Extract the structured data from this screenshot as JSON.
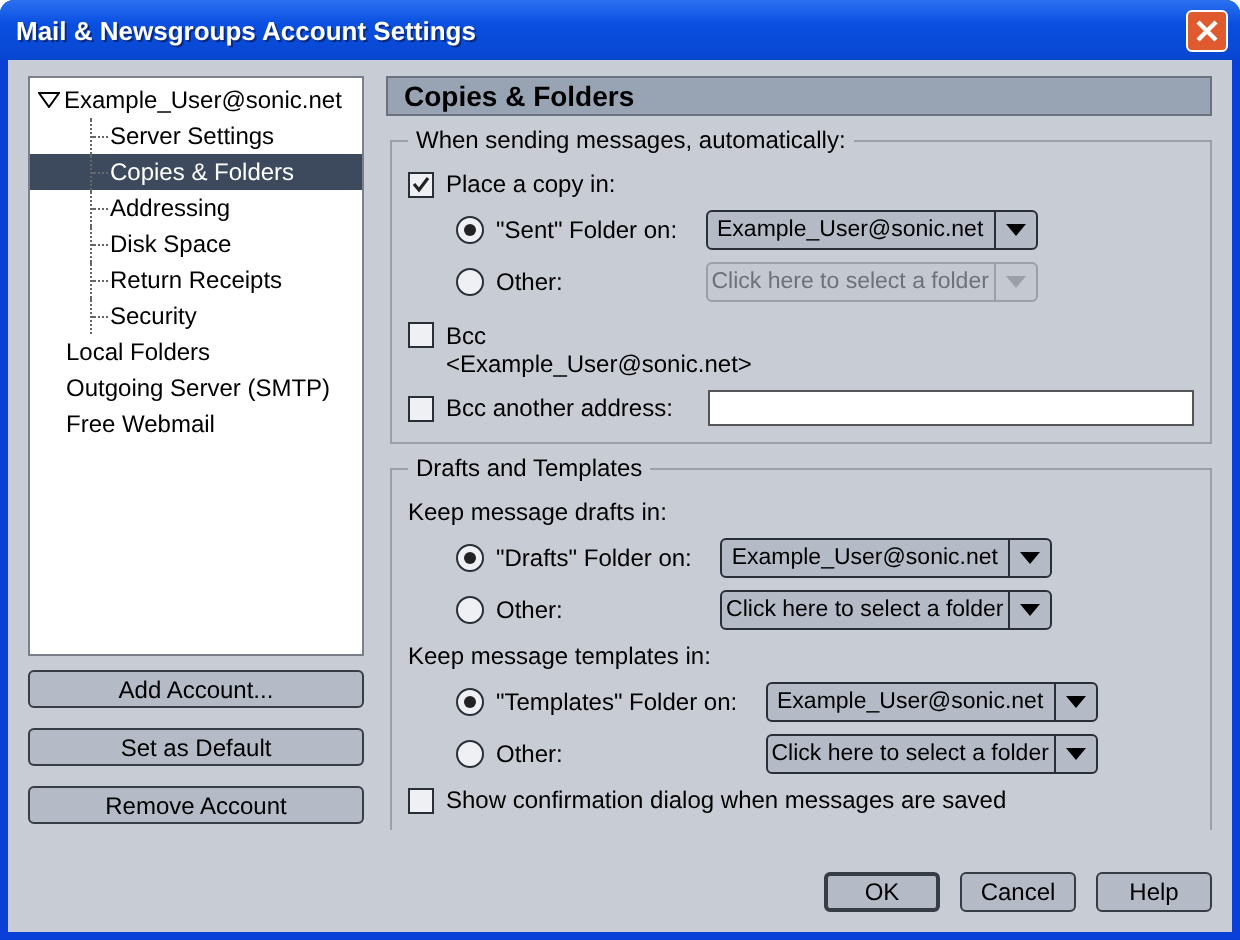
{
  "window": {
    "title": "Mail & Newsgroups Account Settings"
  },
  "tree": [
    {
      "label": "Example_User@sonic.net",
      "expanded": true,
      "selected": false,
      "children": [
        {
          "label": "Server Settings",
          "selected": false
        },
        {
          "label": "Copies & Folders",
          "selected": true
        },
        {
          "label": "Addressing",
          "selected": false
        },
        {
          "label": "Disk Space",
          "selected": false
        },
        {
          "label": "Return Receipts",
          "selected": false
        },
        {
          "label": "Security",
          "selected": false
        }
      ]
    },
    {
      "label": "Local Folders",
      "selected": false
    },
    {
      "label": "Outgoing Server (SMTP)",
      "selected": false
    },
    {
      "label": "Free Webmail",
      "selected": false
    }
  ],
  "account_buttons": [
    "Add Account...",
    "Set as Default",
    "Remove Account"
  ],
  "page_title": "Copies & Folders",
  "sending": {
    "title": "When sending messages, automatically:",
    "place_copy": {
      "label": "Place a copy in:",
      "checked": true
    },
    "radios": [
      {
        "label": "\"Sent\" Folder on:",
        "selected": true,
        "dropdown": {
          "value": "Example_User@sonic.net",
          "disabled": false
        }
      },
      {
        "label": "Other:",
        "selected": false,
        "dropdown": {
          "value": "Click here to select a folder",
          "disabled": true
        }
      }
    ],
    "bcc": {
      "label": "Bcc",
      "address": "<Example_User@sonic.net>",
      "checked": false
    },
    "bcc_other": {
      "label": "Bcc another address:",
      "checked": false
    }
  },
  "drafts": {
    "title": "Drafts and Templates",
    "subsections": [
      {
        "label": "Keep message drafts in:",
        "radios": [
          {
            "label": "\"Drafts\" Folder on:",
            "selected": true,
            "dropdown": {
              "value": "Example_User@sonic.net",
              "disabled": false
            }
          },
          {
            "label": "Other:",
            "selected": false,
            "dropdown": {
              "value": "Click here to select a folder",
              "disabled": false
            }
          }
        ]
      },
      {
        "label": "Keep message templates in:",
        "radios": [
          {
            "label": "\"Templates\" Folder on:",
            "selected": true,
            "dropdown": {
              "value": "Example_User@sonic.net",
              "disabled": false
            }
          },
          {
            "label": "Other:",
            "selected": false,
            "dropdown": {
              "value": "Click here to select a folder",
              "disabled": false
            }
          }
        ]
      }
    ],
    "confirm": {
      "label": "Show confirmation dialog when messages are saved",
      "checked": false
    }
  },
  "dialog_buttons": [
    {
      "label": "OK",
      "default": true
    },
    {
      "label": "Cancel",
      "default": false
    },
    {
      "label": "Help",
      "default": false
    }
  ]
}
